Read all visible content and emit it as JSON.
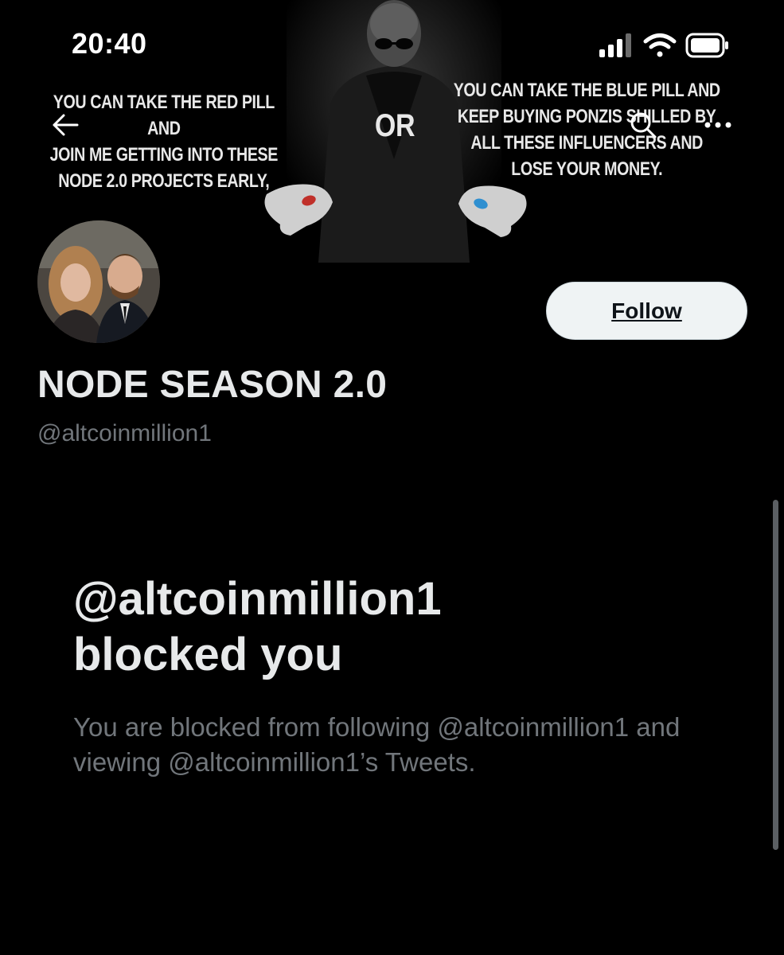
{
  "status_bar": {
    "time": "20:40",
    "icons": [
      "cellular-signal-icon",
      "wifi-icon",
      "battery-icon"
    ]
  },
  "banner": {
    "left_text": "YOU CAN TAKE THE RED PILL AND JOIN ME GETTING INTO THESE NODE 2.0 PROJECTS EARLY,",
    "left_lines": [
      "YOU CAN TAKE THE RED PILL AND",
      "JOIN ME GETTING INTO THESE",
      "NODE 2.0 PROJECTS EARLY,"
    ],
    "center_text": "OR",
    "right_lines": [
      "YOU CAN TAKE THE BLUE PILL AND",
      "KEEP BUYING PONZIS SHILLED BY",
      "ALL THESE INFLUENCERS AND",
      "LOSE YOUR MONEY."
    ]
  },
  "nav": {
    "back_icon": "arrow-left-icon",
    "search_icon": "search-icon",
    "more_icon": "more-horizontal-icon"
  },
  "profile": {
    "display_name": "NODE SEASON 2.0",
    "handle": "@altcoinmillion1",
    "follow_label": "Follow"
  },
  "blocked": {
    "title_line1": "@altcoinmillion1",
    "title_line2": "blocked you",
    "description": "You are blocked from following @altcoinmillion1 and viewing @altcoinmillion1’s Tweets."
  },
  "colors": {
    "background": "#000000",
    "text_primary": "#e7e9ea",
    "text_secondary": "#71767b",
    "follow_bg": "#eff3f4",
    "red_pill": "#c0302a",
    "blue_pill": "#2f8fd0"
  }
}
